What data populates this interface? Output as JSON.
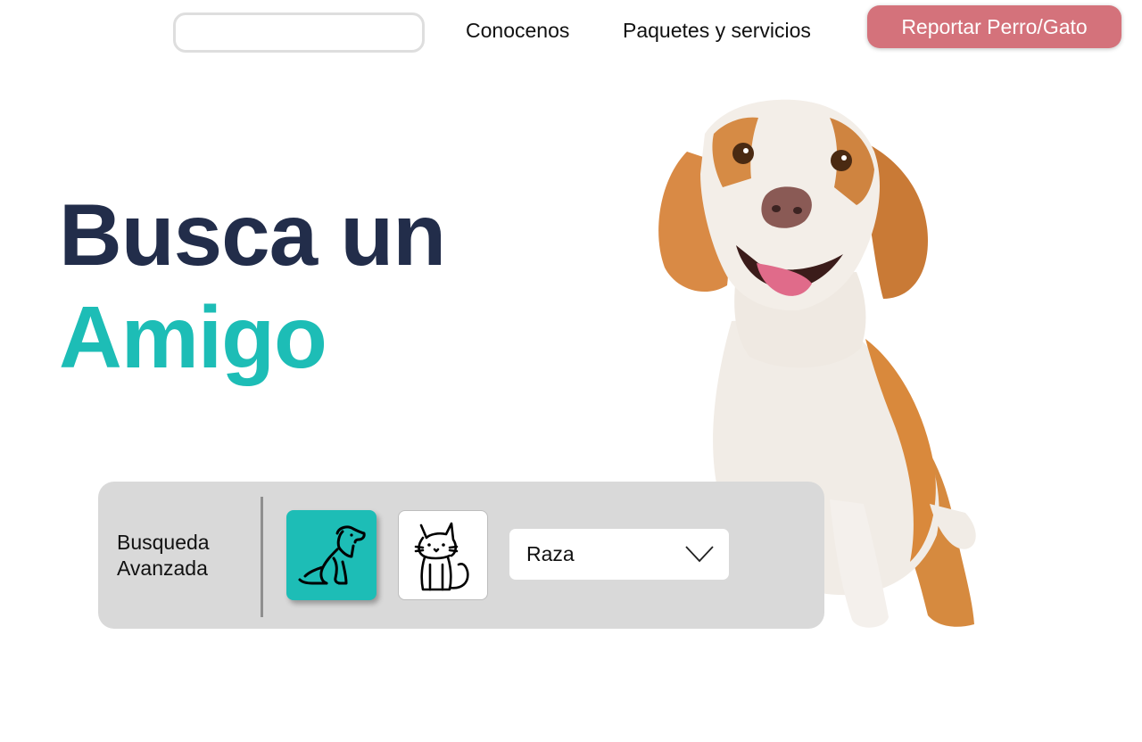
{
  "header": {
    "search": {
      "value": "",
      "placeholder": ""
    },
    "nav": {
      "about_label": "Conocenos",
      "packages_label": "Paquetes y servicios"
    },
    "report_button_label": "Reportar Perro/Gato"
  },
  "hero": {
    "line1": "Busca un",
    "line2": "Amigo"
  },
  "advanced_search": {
    "title_line1": "Busqueda",
    "title_line2": "Avanzada",
    "pet_types": [
      {
        "icon": "dog-icon",
        "selected": true
      },
      {
        "icon": "cat-icon",
        "selected": false
      }
    ],
    "breed_select": {
      "selected": "Raza",
      "icon": "chevron-down-icon"
    }
  },
  "colors": {
    "accent": "#1dbdb6",
    "heading": "#222d4a",
    "report_button": "#d4727b",
    "panel_bg": "#d9d9d9"
  }
}
